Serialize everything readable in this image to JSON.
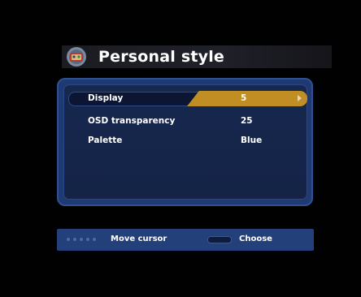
{
  "title": {
    "text": "Personal style",
    "icon": "palette-settings-icon"
  },
  "settings": [
    {
      "label": "Display",
      "value": "5",
      "selected": true
    },
    {
      "label": "OSD transparency",
      "value": "25",
      "selected": false
    },
    {
      "label": "Palette",
      "value": "Blue",
      "selected": false
    }
  ],
  "help": {
    "move_icon": "arrow-keys-icon",
    "move_label": "Move cursor",
    "choose_icon": "ok-key-icon",
    "choose_label": "Choose"
  },
  "colors": {
    "highlight": "#c18e24",
    "panel": "#1f3a73",
    "help_bar": "#24407a"
  }
}
